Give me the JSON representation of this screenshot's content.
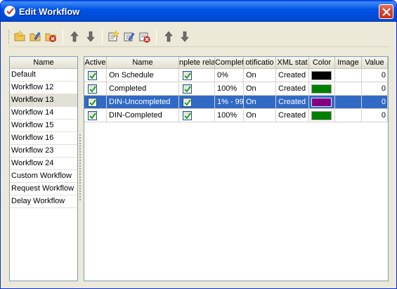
{
  "window": {
    "title": "Edit Workflow"
  },
  "toolbar": {
    "buttons": [
      {
        "name": "add-workflow-button",
        "icon": "folder-add-icon"
      },
      {
        "name": "edit-workflow-button",
        "icon": "folder-edit-icon"
      },
      {
        "name": "delete-workflow-button",
        "icon": "folder-delete-icon"
      },
      {
        "name": "move-workflow-up-button",
        "icon": "arrow-up-icon"
      },
      {
        "name": "move-workflow-down-button",
        "icon": "arrow-down-icon"
      },
      {
        "name": "add-status-button",
        "icon": "status-add-icon"
      },
      {
        "name": "edit-status-button",
        "icon": "status-edit-icon"
      },
      {
        "name": "delete-status-button",
        "icon": "status-delete-icon"
      },
      {
        "name": "move-status-up-button",
        "icon": "arrow-up-icon"
      },
      {
        "name": "move-status-down-button",
        "icon": "arrow-down-icon"
      }
    ]
  },
  "workflows": {
    "header": "Name",
    "selected_index": 2,
    "items": [
      "Default",
      "Workflow 12",
      "Workflow 13",
      "Workflow 14",
      "Workflow 15",
      "Workflow 16",
      "Workflow 23",
      "Workflow 24",
      "Custom Workflow",
      "Request Workflow",
      "Delay Workflow"
    ]
  },
  "statuses": {
    "headers": [
      "Active",
      "Name",
      "nplete rela",
      "Complet",
      "otificatio",
      "XML stat",
      "Color",
      "Image",
      "Value"
    ],
    "selected_index": 2,
    "rows": [
      {
        "active": true,
        "name": "On Schedule",
        "complete_related": true,
        "completion": "0%",
        "notification": "On",
        "xml_status": "Created",
        "color": "#000000",
        "image": "",
        "value": "0"
      },
      {
        "active": true,
        "name": "Completed",
        "complete_related": true,
        "completion": "100%",
        "notification": "On",
        "xml_status": "Created",
        "color": "#008000",
        "image": "",
        "value": "0"
      },
      {
        "active": true,
        "name": "DIN-Uncompleted",
        "complete_related": true,
        "completion": "1% - 99",
        "notification": "On",
        "xml_status": "Created",
        "color": "#800080",
        "image": "",
        "value": "0"
      },
      {
        "active": true,
        "name": "DIN-Completed",
        "complete_related": true,
        "completion": "100%",
        "notification": "On",
        "xml_status": "Created",
        "color": "#008000",
        "image": "",
        "value": "0"
      }
    ]
  },
  "colors": {
    "selection": "#316AC5",
    "titlebar": "#0055E5",
    "window_bg": "#ECE9D8"
  }
}
